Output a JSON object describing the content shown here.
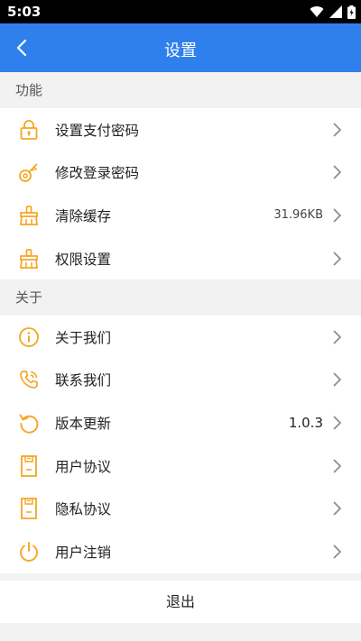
{
  "status": {
    "time": "5:03"
  },
  "header": {
    "title": "设置"
  },
  "sections": [
    {
      "title": "功能",
      "items": [
        {
          "label": "设置支付密码",
          "value": "",
          "icon": "lock-icon"
        },
        {
          "label": "修改登录密码",
          "value": "",
          "icon": "key-icon"
        },
        {
          "label": "清除缓存",
          "value": "31.96KB",
          "icon": "broom-icon"
        },
        {
          "label": "权限设置",
          "value": "",
          "icon": "broom-icon"
        }
      ]
    },
    {
      "title": "关于",
      "items": [
        {
          "label": "关于我们",
          "value": "",
          "icon": "info-icon"
        },
        {
          "label": "联系我们",
          "value": "",
          "icon": "phone-icon"
        },
        {
          "label": "版本更新",
          "value": "1.0.3",
          "icon": "refresh-icon"
        },
        {
          "label": "用户协议",
          "value": "",
          "icon": "document-icon"
        },
        {
          "label": "隐私协议",
          "value": "",
          "icon": "document-icon"
        },
        {
          "label": "用户注销",
          "value": "",
          "icon": "power-icon"
        }
      ]
    }
  ],
  "logout_label": "退出",
  "colors": {
    "header": "#2f80ed",
    "icon": "#f5a623",
    "background": "#f2f2f2"
  }
}
